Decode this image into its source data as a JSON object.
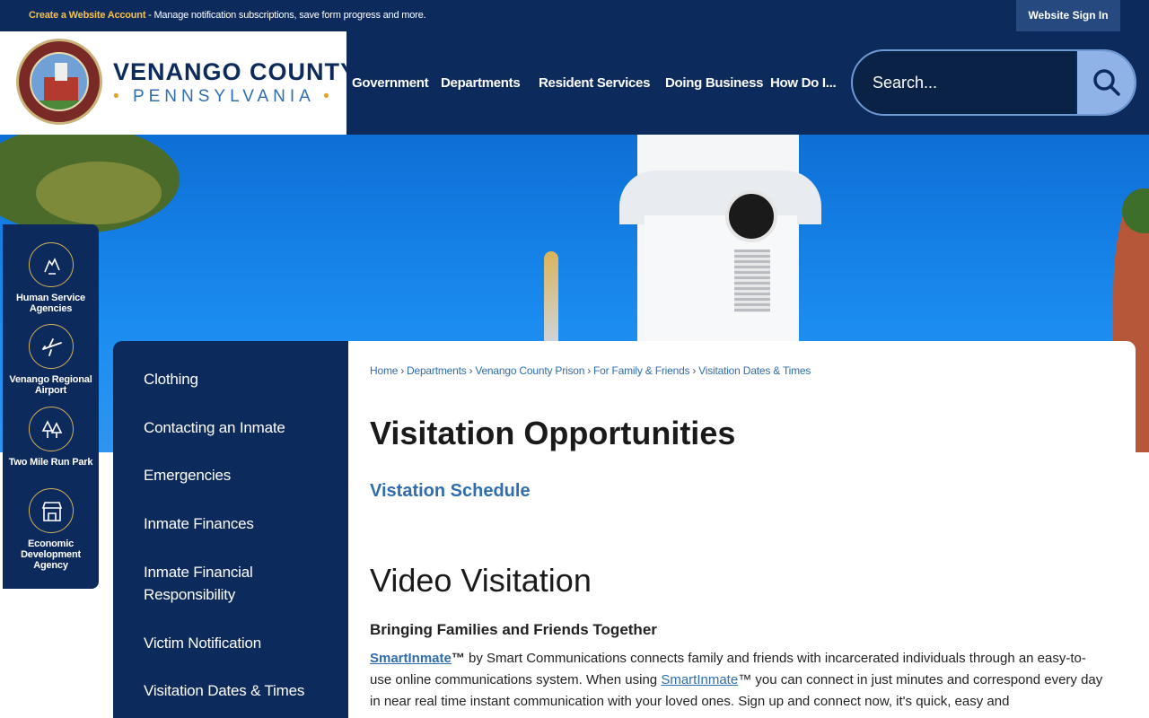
{
  "topbar": {
    "account_link": "Create a Website Account",
    "message": " - Manage notification subscriptions, save form progress and more.",
    "signin": "Website Sign In"
  },
  "header": {
    "county": "VENANGO COUNTY",
    "state": "PENNSYLVANIA",
    "nav": [
      "Government",
      "Departments",
      "Resident Services",
      "Doing Business",
      "How Do I..."
    ],
    "search_placeholder": "Search..."
  },
  "quick_links": [
    {
      "label": "Human Service Agencies",
      "icon": "hands-icon"
    },
    {
      "label": "Venango Regional Airport",
      "icon": "airplane-icon"
    },
    {
      "label": "Two Mile Run Park",
      "icon": "trees-icon"
    },
    {
      "label": "Economic Development Agency",
      "icon": "storefront-icon"
    }
  ],
  "sidenav": [
    "Clothing",
    "Contacting an Inmate",
    "Emergencies",
    "Inmate Finances",
    "Inmate Financial Responsibility",
    "Victim Notification",
    "Visitation Dates & Times"
  ],
  "breadcrumb": [
    "Home",
    "Departments",
    "Venango County Prison",
    "For Family & Friends",
    "Visitation Dates & Times"
  ],
  "content": {
    "title": "Visitation Opportunities",
    "schedule_link": "Vistation Schedule",
    "section_title": "Video Visitation",
    "subtitle": "Bringing Families and Friends Together",
    "link_text": "SmartInmate",
    "tm": "™",
    "p1": " by Smart Communications connects family and friends with incarcerated individuals through an easy-to-use online communications system. When using ",
    "p2": " you can connect in just minutes and correspond every day in near real time instant communication with your loved ones. Sign up and connect now, it's quick, easy and"
  }
}
